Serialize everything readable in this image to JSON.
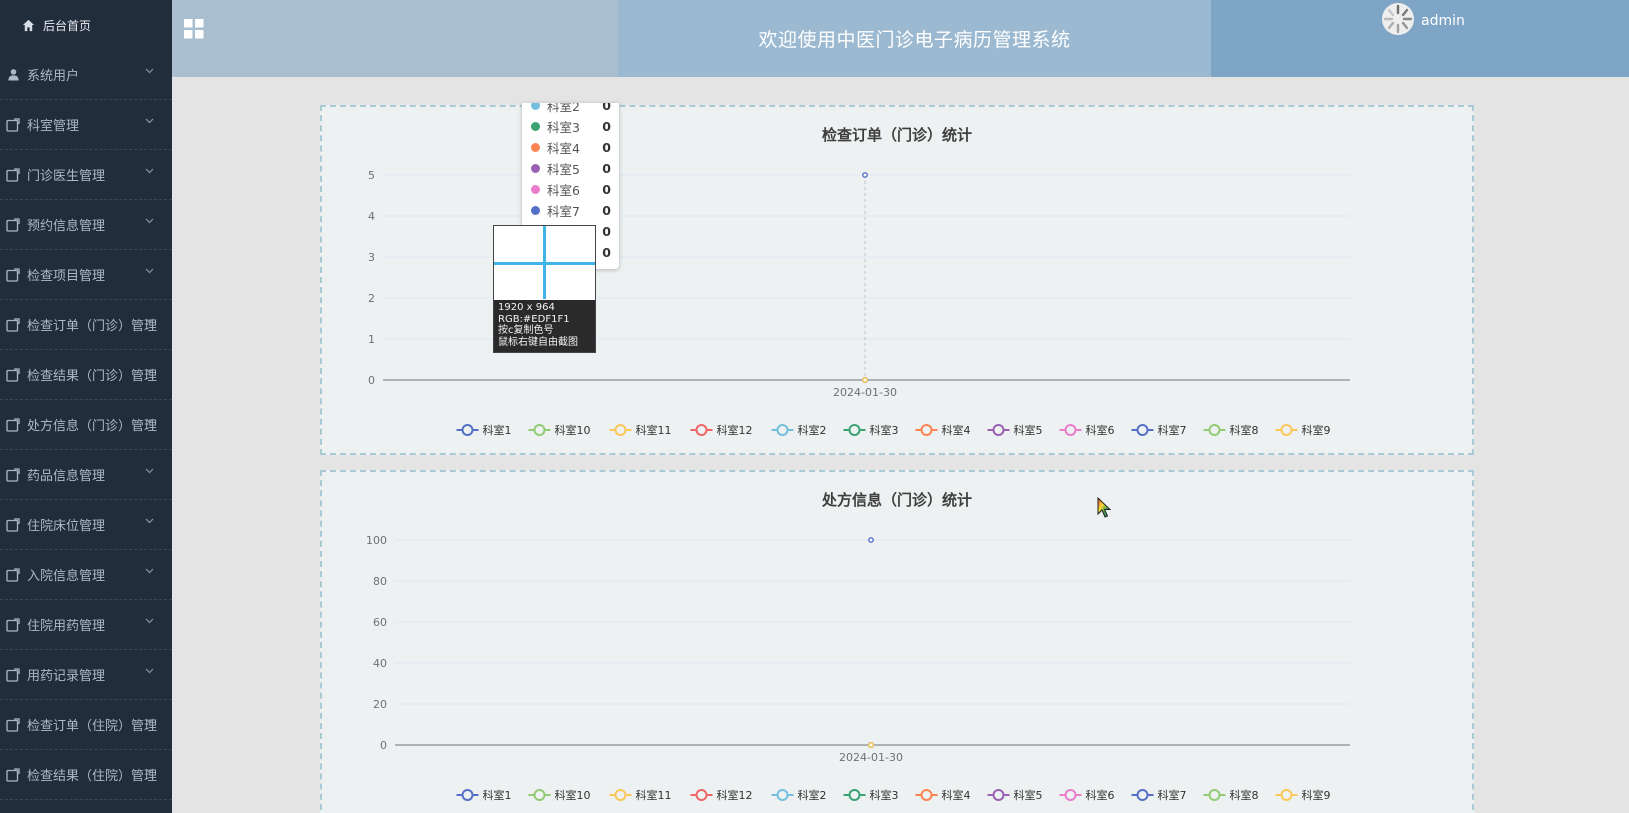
{
  "sidebar": {
    "home_label": "后台首页",
    "items": [
      {
        "label": "系统用户",
        "icon": "user-icon"
      },
      {
        "label": "科室管理",
        "icon": "folder-icon"
      },
      {
        "label": "门诊医生管理",
        "icon": "folder-icon"
      },
      {
        "label": "预约信息管理",
        "icon": "folder-icon"
      },
      {
        "label": "检查项目管理",
        "icon": "folder-icon"
      },
      {
        "label": "检查订单（门诊）管理",
        "icon": "folder-icon"
      },
      {
        "label": "检查结果（门诊）管理",
        "icon": "folder-icon"
      },
      {
        "label": "处方信息（门诊）管理",
        "icon": "folder-icon"
      },
      {
        "label": "药品信息管理",
        "icon": "folder-icon"
      },
      {
        "label": "住院床位管理",
        "icon": "folder-icon"
      },
      {
        "label": "入院信息管理",
        "icon": "folder-icon"
      },
      {
        "label": "住院用药管理",
        "icon": "folder-icon"
      },
      {
        "label": "用药记录管理",
        "icon": "folder-icon"
      },
      {
        "label": "检查订单（住院）管理",
        "icon": "folder-icon"
      },
      {
        "label": "检查结果（住院）管理",
        "icon": "folder-icon"
      }
    ]
  },
  "header": {
    "title": "欢迎使用中医门诊电子病历管理系统",
    "user": "admin",
    "menu_icon": "grid-icon"
  },
  "tooltip": {
    "rows": [
      {
        "name": "科室2",
        "value": "0",
        "color": "#73c0de"
      },
      {
        "name": "科室3",
        "value": "0",
        "color": "#3ba272"
      },
      {
        "name": "科室4",
        "value": "0",
        "color": "#fc8452"
      },
      {
        "name": "科室5",
        "value": "0",
        "color": "#9a60b4"
      },
      {
        "name": "科室6",
        "value": "0",
        "color": "#ea7ccc"
      },
      {
        "name": "科室7",
        "value": "0",
        "color": "#5470c6"
      },
      {
        "name": "",
        "value": "0",
        "color": "#91cc75"
      },
      {
        "name": "",
        "value": "0",
        "color": "#fac858"
      }
    ]
  },
  "color_picker": {
    "line1": "1920 x 964",
    "line2": "RGB:#EDF1F1",
    "line3": "按c复制色号",
    "line4": "鼠标右键自由截图"
  },
  "chart_data": [
    {
      "type": "line",
      "title": "检查订单（门诊）统计",
      "categories": [
        "2024-01-30"
      ],
      "ylim": [
        0,
        5
      ],
      "yticks": [
        0,
        1,
        2,
        3,
        4,
        5
      ],
      "grid": true,
      "legend_position": "bottom",
      "series": [
        {
          "name": "科室1",
          "values": [
            5
          ],
          "color": "#5470c6"
        },
        {
          "name": "科室10",
          "values": [
            0
          ],
          "color": "#91cc75"
        },
        {
          "name": "科室11",
          "values": [
            0
          ],
          "color": "#fac858"
        },
        {
          "name": "科室12",
          "values": [
            0
          ],
          "color": "#ee6666"
        },
        {
          "name": "科室2",
          "values": [
            0
          ],
          "color": "#73c0de"
        },
        {
          "name": "科室3",
          "values": [
            0
          ],
          "color": "#3ba272"
        },
        {
          "name": "科室4",
          "values": [
            0
          ],
          "color": "#fc8452"
        },
        {
          "name": "科室5",
          "values": [
            0
          ],
          "color": "#9a60b4"
        },
        {
          "name": "科室6",
          "values": [
            0
          ],
          "color": "#ea7ccc"
        },
        {
          "name": "科室7",
          "values": [
            0
          ],
          "color": "#5470c6"
        },
        {
          "name": "科室8",
          "values": [
            0
          ],
          "color": "#91cc75"
        },
        {
          "name": "科室9",
          "values": [
            0
          ],
          "color": "#fac858"
        }
      ]
    },
    {
      "type": "line",
      "title": "处方信息（门诊）统计",
      "categories": [
        "2024-01-30"
      ],
      "ylim": [
        0,
        100
      ],
      "yticks": [
        0,
        20,
        40,
        60,
        80,
        100
      ],
      "grid": true,
      "legend_position": "bottom",
      "series": [
        {
          "name": "科室1",
          "values": [
            100
          ],
          "color": "#5470c6"
        },
        {
          "name": "科室10",
          "values": [
            0
          ],
          "color": "#91cc75"
        },
        {
          "name": "科室11",
          "values": [
            0
          ],
          "color": "#fac858"
        },
        {
          "name": "科室12",
          "values": [
            0
          ],
          "color": "#ee6666"
        },
        {
          "name": "科室2",
          "values": [
            0
          ],
          "color": "#73c0de"
        },
        {
          "name": "科室3",
          "values": [
            0
          ],
          "color": "#3ba272"
        },
        {
          "name": "科室4",
          "values": [
            0
          ],
          "color": "#fc8452"
        },
        {
          "name": "科室5",
          "values": [
            0
          ],
          "color": "#9a60b4"
        },
        {
          "name": "科室6",
          "values": [
            0
          ],
          "color": "#ea7ccc"
        },
        {
          "name": "科室7",
          "values": [
            0
          ],
          "color": "#5470c6"
        },
        {
          "name": "科室8",
          "values": [
            0
          ],
          "color": "#91cc75"
        },
        {
          "name": "科室9",
          "values": [
            0
          ],
          "color": "#fac858"
        }
      ]
    }
  ]
}
